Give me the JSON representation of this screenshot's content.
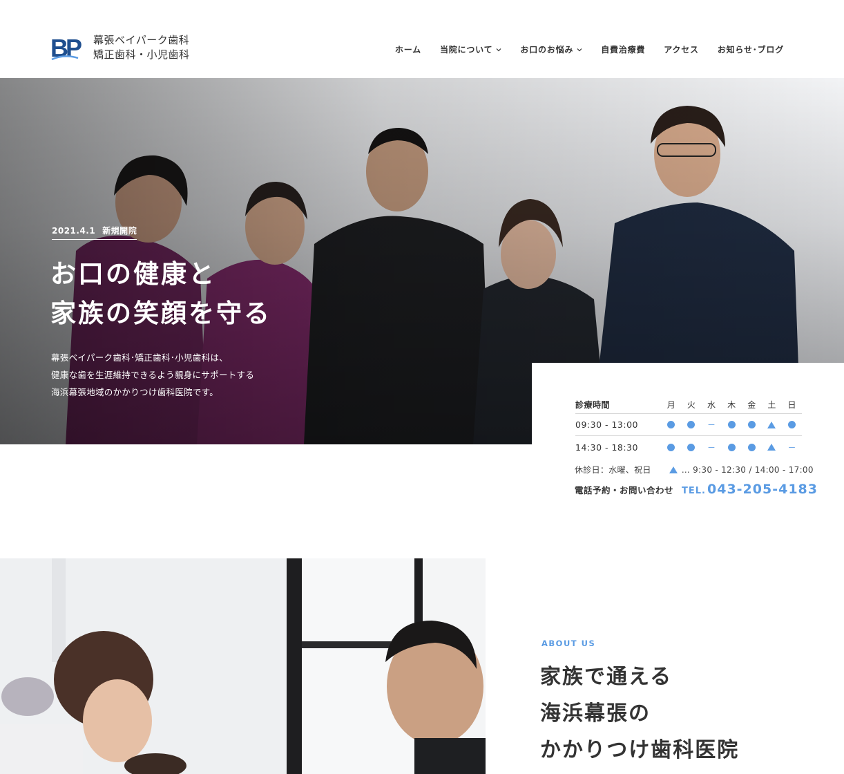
{
  "header": {
    "logo_mark_text": "BP",
    "logo_line1": "幕張ベイパーク歯科",
    "logo_line2": "矯正歯科・小児歯科",
    "nav": [
      {
        "label": "ホーム",
        "dropdown": false
      },
      {
        "label": "当院について",
        "dropdown": true
      },
      {
        "label": "お口のお悩み",
        "dropdown": true
      },
      {
        "label": "自費治療費",
        "dropdown": false
      },
      {
        "label": "アクセス",
        "dropdown": false
      },
      {
        "label": "お知らせ･ブログ",
        "dropdown": false
      }
    ]
  },
  "hero": {
    "badge_date": "2021.4.1",
    "badge_text": "新規開院",
    "title_line1": "お口の健康と",
    "title_line2": "家族の笑顔を守る",
    "lead_line1": "幕張ベイパーク歯科･矯正歯科･小児歯科は、",
    "lead_line2": "健康な歯を生涯維持できるよう親身にサポートする",
    "lead_line3": "海浜幕張地域のかかりつけ歯科医院です。"
  },
  "schedule": {
    "header_label": "診療時間",
    "days": [
      "月",
      "火",
      "水",
      "木",
      "金",
      "土",
      "日"
    ],
    "rows": [
      {
        "time": "09:30 - 13:00",
        "marks": [
          "dot",
          "dot",
          "dash",
          "dot",
          "dot",
          "tri",
          "dot"
        ]
      },
      {
        "time": "14:30 - 18:30",
        "marks": [
          "dot",
          "dot",
          "dash",
          "dot",
          "dot",
          "tri",
          "dash"
        ]
      }
    ],
    "dash_symbol": "－",
    "closed_text": "休診日：水曜、祝日",
    "saturday_hours": "… 9:30 - 12:30 / 14:00 - 17:00",
    "phone_label": "電話予約・お問い合わせ",
    "phone_prefix": "TEL.",
    "phone_number": "043-205-4183",
    "accent_color": "#5a9be3"
  },
  "about": {
    "eyebrow": "ABOUT US",
    "title_line1": "家族で通える",
    "title_line2": "海浜幕張の",
    "title_line3": "かかりつけ歯科医院"
  }
}
